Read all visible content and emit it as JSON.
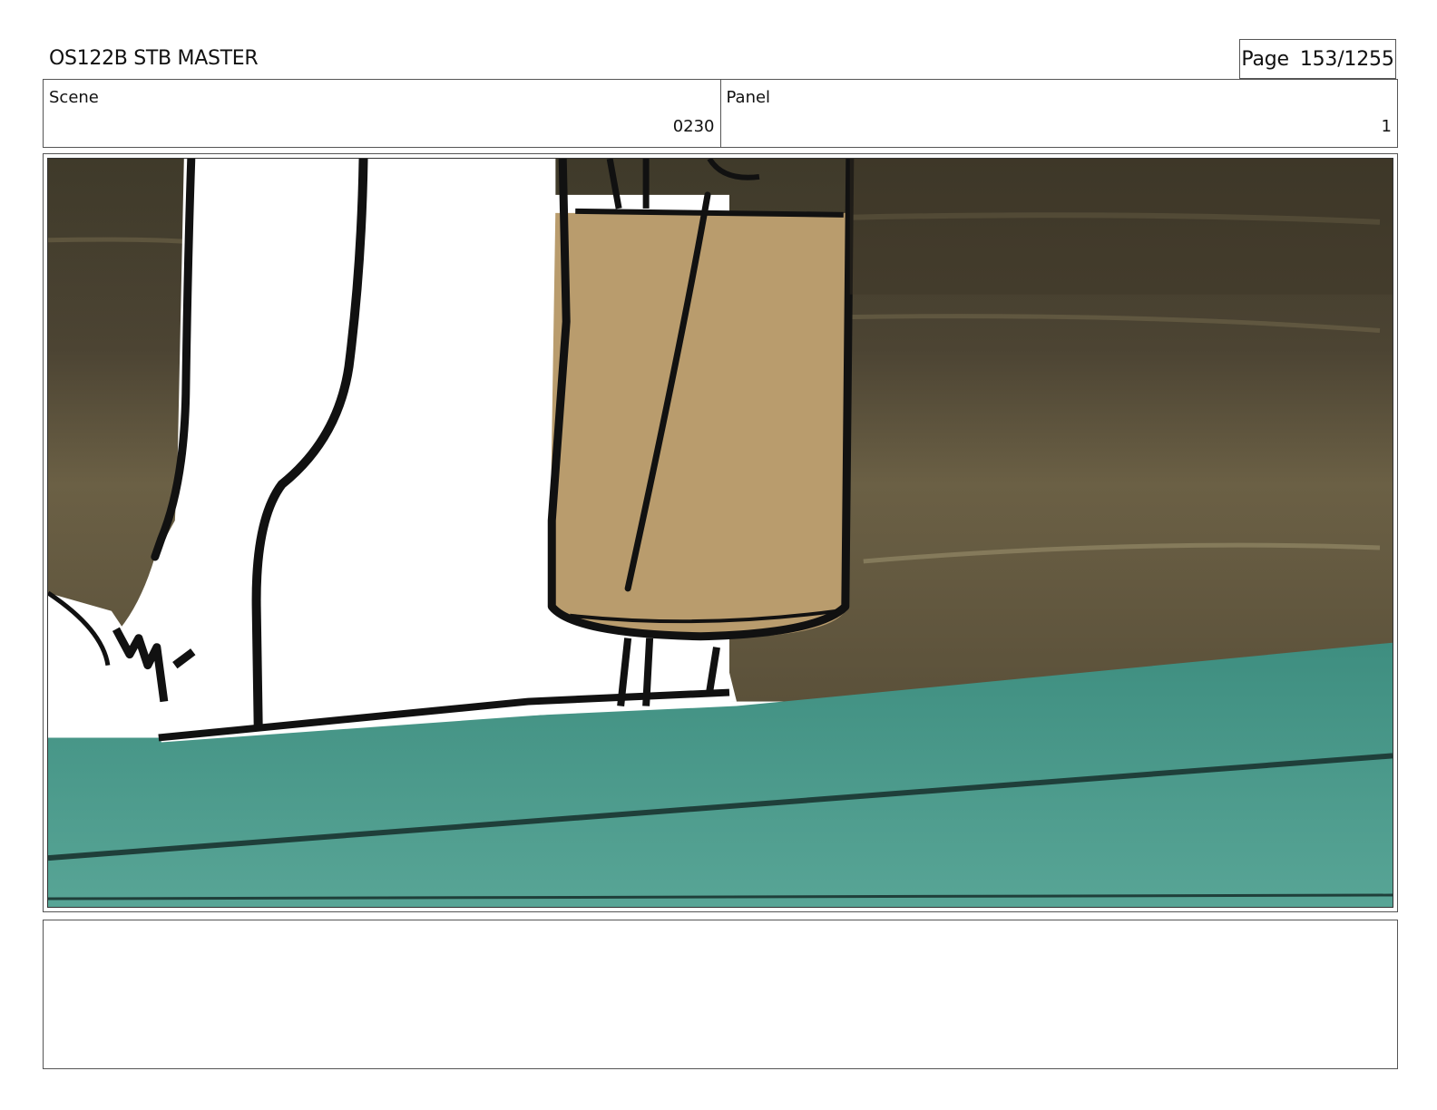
{
  "header": {
    "title": "OS122B STB MASTER",
    "page_label": "Page",
    "page_number": "153/1255"
  },
  "info": {
    "scene_label": "Scene",
    "scene_value": "0230",
    "panel_label": "Panel",
    "panel_value": "1"
  },
  "frame": {
    "description_icon": "storyboard-drawing",
    "colors": {
      "wall": "#5a4f38",
      "floor": "#4f9a8c",
      "bag": "#b99c6d",
      "line": "#111111"
    }
  },
  "notes": {
    "text": ""
  }
}
